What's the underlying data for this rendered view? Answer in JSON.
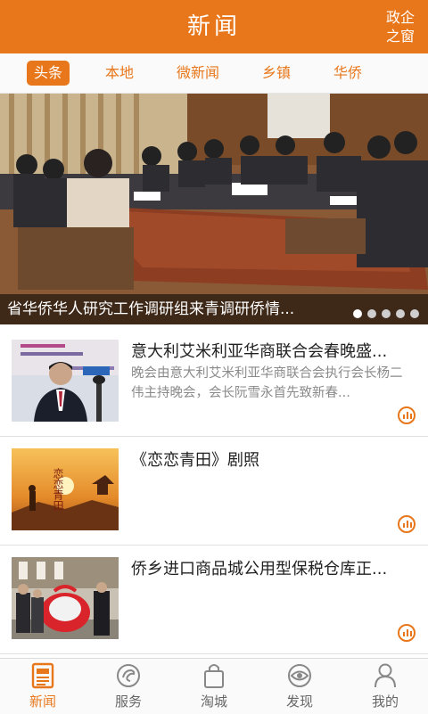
{
  "header": {
    "title": "新闻",
    "corner_line1": "政企",
    "corner_line2": "之窗"
  },
  "tabs": [
    {
      "label": "头条",
      "active": true
    },
    {
      "label": "本地",
      "active": false
    },
    {
      "label": "微新闻",
      "active": false
    },
    {
      "label": "乡镇",
      "active": false
    },
    {
      "label": "华侨",
      "active": false
    }
  ],
  "hero": {
    "caption": "省华侨华人研究工作调研组来青调研侨情...",
    "slide_count": 5,
    "active_slide": 1
  },
  "news": [
    {
      "title": "意大利艾米利亚华商联合会春晚盛...",
      "summary": "晚会由意大利艾米利亚华商联合会执行会长杨二伟主持晚会，会长阮雪永首先致新春..."
    },
    {
      "title": "《恋恋青田》剧照",
      "summary": "",
      "thumb_text": "恋恋青田"
    },
    {
      "title": "侨乡进口商品城公用型保税仓库正...",
      "summary": ""
    }
  ],
  "bottom_nav": [
    {
      "label": "新闻",
      "icon": "newspaper-icon",
      "active": true
    },
    {
      "label": "服务",
      "icon": "service-icon",
      "active": false
    },
    {
      "label": "淘城",
      "icon": "shopping-bag-icon",
      "active": false
    },
    {
      "label": "发现",
      "icon": "eye-icon",
      "active": false
    },
    {
      "label": "我的",
      "icon": "user-icon",
      "active": false
    }
  ],
  "colors": {
    "accent": "#e8771b",
    "summary_text": "#8a8a8a",
    "tab_bg": "#fafafa"
  }
}
